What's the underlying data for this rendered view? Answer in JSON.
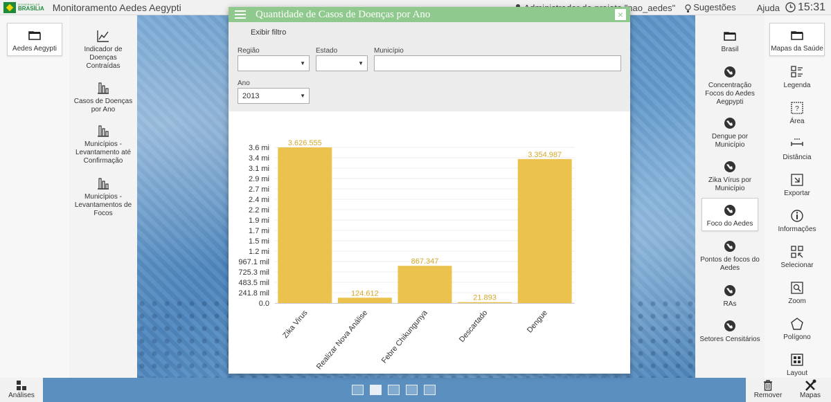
{
  "topbar": {
    "logo_small": "GOVERNO DE",
    "logo_big": "BRASÍLIA",
    "app_title": "Monitoramento Aedes Aegypti",
    "user": "Administrador do projeto \"nao_aedes\"",
    "suggestions": "Sugestões",
    "help": "Ajuda",
    "time": "15:31"
  },
  "left_panel": {
    "tab": "Aedes Aegypti",
    "items": [
      "Indicador de Doenças Contraídas",
      "Casos de Doenças por Ano",
      "Municípios - Levantamento até Confirmação",
      "Municípios - Levantamentos de Focos"
    ]
  },
  "right_panel": {
    "layers": [
      "Brasil",
      "Concentração Focos do Aedes Aegpypti",
      "Dengue por Município",
      "Zika Vírus por Município",
      "Foco do Aedes",
      "Pontos de focos do Aedes",
      "RAs",
      "Setores Censitários"
    ],
    "tools_tab": "Mapas da Saúde",
    "tools": [
      "Legenda",
      "Área",
      "Distância",
      "Exportar",
      "Informações",
      "Selecionar",
      "Zoom",
      "Polígono",
      "Layout"
    ]
  },
  "bottom": {
    "left_label": "Análises",
    "remove_label": "Remover",
    "maps_label": "Mapas",
    "pages": 5,
    "active_page": 2
  },
  "modal": {
    "title": "Quantidade de Casos de Doenças por Ano",
    "close": "×",
    "show_filter": "Exibir filtro",
    "filters": {
      "regiao_label": "Região",
      "regiao_value": "",
      "estado_label": "Estado",
      "estado_value": "",
      "municipio_label": "Município",
      "municipio_value": "",
      "ano_label": "Ano",
      "ano_value": "2013"
    }
  },
  "colors": {
    "bar": "#ebc24d",
    "label": "#d4a82a",
    "header": "#8fc98d"
  },
  "chart_data": {
    "type": "bar",
    "categories": [
      "Zika Virus",
      "Realizar Nova Análise",
      "Febre Chikungunya",
      "Descartado",
      "Dengue"
    ],
    "values": [
      3626555,
      124612,
      867347,
      21893,
      3354987
    ],
    "value_labels": [
      "3.626.555",
      "124.612",
      "867.347",
      "21.893",
      "3.354.987"
    ],
    "ylim": [
      0,
      3626555
    ],
    "y_ticks": [
      "0.0",
      "241.8 mil",
      "483.5 mil",
      "725.3 mil",
      "967.1 mil",
      "1.2 mi",
      "1.5 mi",
      "1.7 mi",
      "1.9 mi",
      "2.2 mi",
      "2.4 mi",
      "2.7 mi",
      "2.9 mi",
      "3.1 mi",
      "3.4 mi",
      "3.6 mi"
    ],
    "grid": true,
    "legend": "none"
  }
}
